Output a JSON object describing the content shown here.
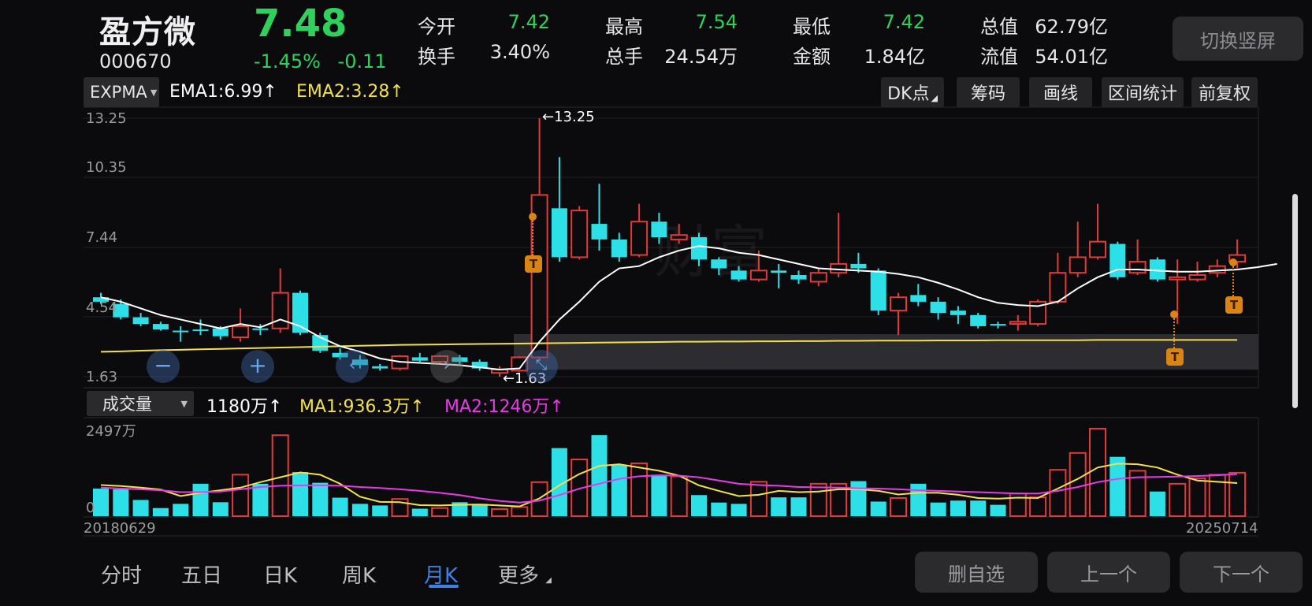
{
  "header": {
    "name": "盈方微",
    "code": "000670",
    "price": "7.48",
    "change_pct": "-1.45%",
    "change_abs": "-0.11",
    "switch_button": "切换竖屏",
    "stats": [
      {
        "label": "今开",
        "value": "7.42",
        "colored": true
      },
      {
        "label": "换手",
        "value": "3.40%",
        "colored": false
      },
      {
        "label": "最高",
        "value": "7.54",
        "colored": true
      },
      {
        "label": "总手",
        "value": "24.54万",
        "colored": false
      },
      {
        "label": "最低",
        "value": "7.42",
        "colored": true
      },
      {
        "label": "金额",
        "value": "1.84亿",
        "colored": false
      },
      {
        "label": "总值",
        "value": "62.79亿",
        "colored": false
      },
      {
        "label": "流值",
        "value": "54.01亿",
        "colored": false
      }
    ]
  },
  "main_indicator": {
    "selector": "EXPMA",
    "ema1": "EMA1:6.99↑",
    "ema2": "EMA2:3.28↑"
  },
  "toolbar": {
    "dk": "DK点",
    "chips": "筹码",
    "draw": "画线",
    "range_stats": "区间统计",
    "adjust": "前复权"
  },
  "price_axis": [
    "13.25",
    "10.35",
    "7.44",
    "4.54",
    "1.63"
  ],
  "markers": {
    "high": "←13.25",
    "low": "←1.63",
    "t": "T"
  },
  "volume_indicator": {
    "selector": "成交量",
    "vol": "1180万↑",
    "ma1": "MA1:936.3万↑",
    "ma2": "MA2:1246万↑"
  },
  "volume_axis": {
    "max": "2497万",
    "min": "0"
  },
  "dates": {
    "start": "20180629",
    "end": "20250714"
  },
  "tabs": [
    "分时",
    "五日",
    "日K",
    "周K",
    "月K",
    "更多"
  ],
  "active_tab": "月K",
  "buttons": {
    "remove": "删自选",
    "prev": "上一个",
    "next": "下一个"
  },
  "colors": {
    "up": "#e03a3a",
    "down": "#2de0e8",
    "ema1": "#ffffff",
    "ema2": "#f2e04a",
    "ma1": "#f2e04a",
    "ma2": "#e63be6",
    "accent": "#3f7fe0",
    "price": "#2fd15c"
  },
  "chart_data": {
    "type": "candlestick",
    "y_range": [
      1.63,
      13.25
    ],
    "candles": [
      {
        "o": 5.2,
        "c": 5.0,
        "h": 5.4,
        "l": 4.9
      },
      {
        "o": 4.9,
        "c": 4.3,
        "h": 5.1,
        "l": 4.2
      },
      {
        "o": 4.3,
        "c": 4.0,
        "h": 4.5,
        "l": 3.9
      },
      {
        "o": 4.0,
        "c": 3.75,
        "h": 4.1,
        "l": 3.7
      },
      {
        "o": 3.7,
        "c": 3.65,
        "h": 3.9,
        "l": 3.2
      },
      {
        "o": 3.75,
        "c": 3.68,
        "h": 4.2,
        "l": 3.5
      },
      {
        "o": 3.8,
        "c": 3.45,
        "h": 3.9,
        "l": 3.3
      },
      {
        "o": 3.4,
        "c": 3.9,
        "h": 4.7,
        "l": 3.2
      },
      {
        "o": 3.8,
        "c": 3.75,
        "h": 4.0,
        "l": 3.5
      },
      {
        "o": 3.8,
        "c": 5.4,
        "h": 6.5,
        "l": 3.6
      },
      {
        "o": 5.4,
        "c": 3.6,
        "h": 5.5,
        "l": 3.5
      },
      {
        "o": 3.5,
        "c": 2.8,
        "h": 3.6,
        "l": 2.7
      },
      {
        "o": 2.7,
        "c": 2.5,
        "h": 2.9,
        "l": 2.4
      },
      {
        "o": 2.4,
        "c": 2.15,
        "h": 2.6,
        "l": 2.0
      },
      {
        "o": 2.1,
        "c": 2.0,
        "h": 2.2,
        "l": 1.9
      },
      {
        "o": 2.0,
        "c": 2.55,
        "h": 2.6,
        "l": 1.9
      },
      {
        "o": 2.5,
        "c": 2.35,
        "h": 2.7,
        "l": 2.3
      },
      {
        "o": 2.3,
        "c": 2.55,
        "h": 2.6,
        "l": 2.2
      },
      {
        "o": 2.5,
        "c": 2.3,
        "h": 2.6,
        "l": 2.2
      },
      {
        "o": 2.3,
        "c": 2.0,
        "h": 2.4,
        "l": 1.9
      },
      {
        "o": 1.8,
        "c": 1.95,
        "h": 2.1,
        "l": 1.63
      },
      {
        "o": 1.9,
        "c": 2.5,
        "h": 2.55,
        "l": 1.85
      },
      {
        "o": 2.5,
        "c": 9.8,
        "h": 13.25,
        "l": 2.4
      },
      {
        "o": 9.2,
        "c": 7.0,
        "h": 11.5,
        "l": 6.8
      },
      {
        "o": 7.0,
        "c": 9.1,
        "h": 9.3,
        "l": 6.9
      },
      {
        "o": 8.5,
        "c": 7.8,
        "h": 10.3,
        "l": 7.3
      },
      {
        "o": 7.8,
        "c": 7.0,
        "h": 8.1,
        "l": 6.8
      },
      {
        "o": 7.1,
        "c": 8.6,
        "h": 9.4,
        "l": 7.0
      },
      {
        "o": 8.6,
        "c": 7.9,
        "h": 9.0,
        "l": 7.6
      },
      {
        "o": 7.8,
        "c": 8.0,
        "h": 8.5,
        "l": 7.6
      },
      {
        "o": 7.9,
        "c": 6.9,
        "h": 8.1,
        "l": 6.6
      },
      {
        "o": 6.9,
        "c": 6.5,
        "h": 7.0,
        "l": 6.2
      },
      {
        "o": 6.4,
        "c": 6.0,
        "h": 6.6,
        "l": 5.9
      },
      {
        "o": 6.0,
        "c": 6.4,
        "h": 7.3,
        "l": 5.9
      },
      {
        "o": 6.4,
        "c": 6.3,
        "h": 6.7,
        "l": 5.6
      },
      {
        "o": 6.2,
        "c": 6.0,
        "h": 6.4,
        "l": 5.8
      },
      {
        "o": 5.9,
        "c": 6.3,
        "h": 6.5,
        "l": 5.7
      },
      {
        "o": 6.3,
        "c": 6.7,
        "h": 9.0,
        "l": 6.1
      },
      {
        "o": 6.7,
        "c": 6.5,
        "h": 7.2,
        "l": 6.3
      },
      {
        "o": 6.4,
        "c": 4.6,
        "h": 6.5,
        "l": 4.4
      },
      {
        "o": 4.6,
        "c": 5.2,
        "h": 5.4,
        "l": 3.5
      },
      {
        "o": 5.3,
        "c": 5.0,
        "h": 5.8,
        "l": 4.8
      },
      {
        "o": 5.0,
        "c": 4.5,
        "h": 5.2,
        "l": 4.2
      },
      {
        "o": 4.6,
        "c": 4.4,
        "h": 4.8,
        "l": 4.0
      },
      {
        "o": 4.4,
        "c": 3.9,
        "h": 4.5,
        "l": 3.8
      },
      {
        "o": 4.0,
        "c": 3.95,
        "h": 4.1,
        "l": 3.8
      },
      {
        "o": 4.0,
        "c": 4.1,
        "h": 4.4,
        "l": 3.7
      },
      {
        "o": 4.0,
        "c": 5.0,
        "h": 5.1,
        "l": 3.9
      },
      {
        "o": 5.0,
        "c": 6.3,
        "h": 7.2,
        "l": 4.9
      },
      {
        "o": 6.3,
        "c": 7.0,
        "h": 8.6,
        "l": 6.1
      },
      {
        "o": 7.0,
        "c": 7.7,
        "h": 9.4,
        "l": 6.9
      },
      {
        "o": 7.6,
        "c": 6.1,
        "h": 7.7,
        "l": 6.0
      },
      {
        "o": 6.3,
        "c": 6.8,
        "h": 7.8,
        "l": 6.2
      },
      {
        "o": 6.9,
        "c": 6.0,
        "h": 7.0,
        "l": 5.9
      },
      {
        "o": 6.0,
        "c": 6.1,
        "h": 6.9,
        "l": 4.0
      },
      {
        "o": 6.0,
        "c": 6.2,
        "h": 6.8,
        "l": 5.9
      },
      {
        "o": 6.3,
        "c": 6.6,
        "h": 6.9,
        "l": 6.1
      },
      {
        "o": 6.8,
        "c": 7.1,
        "h": 7.8,
        "l": 6.5
      }
    ],
    "ema1": [
      5.2,
      5.0,
      4.7,
      4.4,
      4.2,
      4.0,
      3.8,
      4.0,
      3.85,
      4.2,
      3.9,
      3.4,
      3.0,
      2.75,
      2.45,
      2.3,
      2.25,
      2.2,
      2.15,
      2.05,
      1.95,
      2.0,
      3.2,
      4.2,
      5.0,
      5.9,
      6.5,
      6.6,
      7.0,
      7.3,
      7.5,
      7.4,
      7.2,
      7.1,
      6.9,
      6.7,
      6.5,
      6.45,
      6.4,
      6.35,
      6.25,
      6.1,
      5.85,
      5.55,
      5.2,
      4.95,
      4.85,
      4.8,
      5.0,
      5.6,
      6.1,
      6.45,
      6.45,
      6.4,
      6.35,
      6.35,
      6.4,
      6.45,
      6.55,
      6.7
    ],
    "ema2": [
      2.75,
      2.77,
      2.8,
      2.82,
      2.84,
      2.86,
      2.88,
      2.9,
      2.92,
      2.94,
      2.96,
      2.98,
      3.0,
      3.02,
      3.04,
      3.06,
      3.07,
      3.08,
      3.09,
      3.1,
      3.11,
      3.12,
      3.13,
      3.14,
      3.15,
      3.16,
      3.17,
      3.18,
      3.19,
      3.2,
      3.2,
      3.21,
      3.21,
      3.22,
      3.22,
      3.23,
      3.23,
      3.24,
      3.24,
      3.25,
      3.25,
      3.25,
      3.26,
      3.26,
      3.26,
      3.27,
      3.27,
      3.27,
      3.27,
      3.27,
      3.28,
      3.28,
      3.28,
      3.28,
      3.28,
      3.28,
      3.28,
      3.28
    ],
    "volume": {
      "unit": "万",
      "max": 2497,
      "values": [
        850,
        830,
        500,
        250,
        380,
        1000,
        430,
        1280,
        1000,
        2497,
        1360,
        1030,
        570,
        380,
        330,
        530,
        230,
        250,
        430,
        380,
        220,
        280,
        1050,
        2100,
        1750,
        2500,
        1580,
        1630,
        1280,
        1230,
        650,
        420,
        380,
        1060,
        580,
        580,
        1000,
        1000,
        1080,
        450,
        560,
        1000,
        420,
        480,
        480,
        350,
        700,
        580,
        1430,
        1950,
        2700,
        1830,
        1400,
        760,
        1000,
        1160,
        1280,
        1340
      ],
      "ma1": [
        960,
        930,
        880,
        820,
        620,
        720,
        800,
        880,
        1050,
        1200,
        1350,
        1280,
        1000,
        600,
        440,
        430,
        340,
        330,
        350,
        360,
        330,
        300,
        550,
        950,
        1300,
        1550,
        1600,
        1500,
        1400,
        1250,
        950,
        780,
        620,
        660,
        780,
        740,
        760,
        830,
        830,
        780,
        670,
        720,
        720,
        660,
        560,
        540,
        570,
        560,
        850,
        1150,
        1500,
        1620,
        1600,
        1500,
        1280,
        1100,
        1060,
        1020
      ],
      "ma2": [
        880,
        850,
        830,
        800,
        740,
        740,
        760,
        830,
        900,
        940,
        950,
        950,
        940,
        900,
        870,
        830,
        780,
        720,
        650,
        550,
        470,
        420,
        480,
        650,
        850,
        1000,
        1150,
        1230,
        1260,
        1250,
        1200,
        1100,
        1000,
        960,
        940,
        900,
        890,
        880,
        860,
        850,
        830,
        800,
        780,
        760,
        740,
        720,
        700,
        700,
        780,
        900,
        1050,
        1150,
        1200,
        1210,
        1220,
        1240,
        1260,
        1300
      ]
    }
  }
}
